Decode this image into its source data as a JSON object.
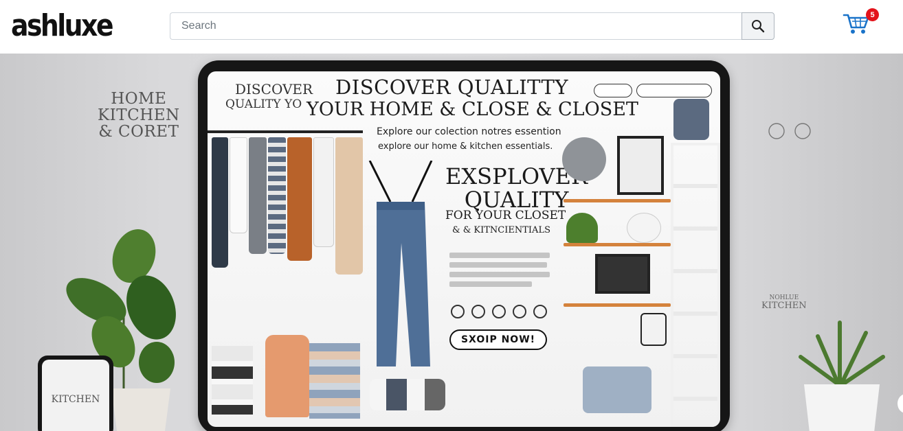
{
  "header": {
    "logo": "ashluxe",
    "search": {
      "placeholder": "Search",
      "value": ""
    },
    "cart": {
      "count": "5"
    }
  },
  "hero": {
    "wall_left": [
      "HOME",
      "KITCHEN",
      "& CORET"
    ],
    "wall_right": [
      "NOHLUE",
      "KITCHEN"
    ],
    "phone_label": "KITCHEN",
    "screen": {
      "headline_left_1": "DISCOVER",
      "headline_left_2": "QUALITY YO",
      "headline_1": "DISCOVER QUALITTY",
      "headline_2": "YOUR   HOME & CLOSE & CLOSET",
      "sub_1": "Explore our colection notres essention",
      "sub_2": "explore our home & kitchen essentials.",
      "big_1": "EXSPLOVER",
      "big_2": "QUALITY",
      "big_3": "FOR YOUR CLOSET",
      "big_4": "& & KITNCIENTIALS",
      "shop_button": "SXOIP NOW!"
    }
  },
  "colors": {
    "cart_badge": "#e3131b",
    "cart_icon": "#1a73c9",
    "shelf": "#d4823c",
    "tablet_frame": "#161616"
  }
}
